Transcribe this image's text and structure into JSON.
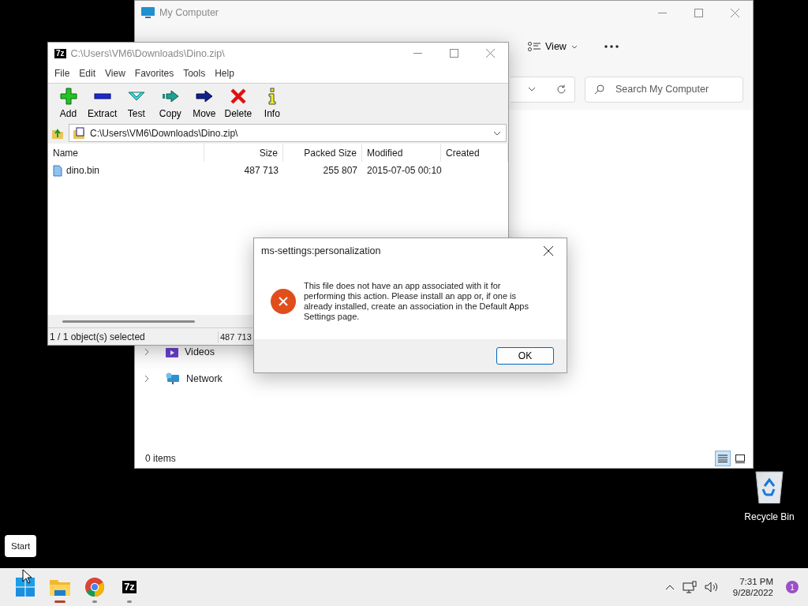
{
  "explorer": {
    "title": "My Computer",
    "view_button": "View",
    "search": {
      "placeholder": "Search My Computer"
    },
    "nav_items": [
      {
        "label": "Videos",
        "kind": "videos",
        "expanded": false
      },
      {
        "label": "Network",
        "kind": "network",
        "expanded": false
      }
    ],
    "status": "0 items",
    "view_modes": [
      {
        "kind": "details",
        "selected": true
      },
      {
        "kind": "tiles",
        "selected": false
      }
    ]
  },
  "sevenzip": {
    "logo": "7z",
    "title": "C:\\Users\\VM6\\Downloads\\Dino.zip\\",
    "menu": [
      "File",
      "Edit",
      "View",
      "Favorites",
      "Tools",
      "Help"
    ],
    "toolbar": [
      {
        "label": "Add",
        "kind": "add"
      },
      {
        "label": "Extract",
        "kind": "extract"
      },
      {
        "label": "Test",
        "kind": "test"
      },
      {
        "label": "Copy",
        "kind": "copy"
      },
      {
        "label": "Move",
        "kind": "move"
      },
      {
        "label": "Delete",
        "kind": "delete"
      },
      {
        "label": "Info",
        "kind": "info"
      }
    ],
    "address": "C:\\Users\\VM6\\Downloads\\Dino.zip\\",
    "columns": [
      "Name",
      "Size",
      "Packed Size",
      "Modified",
      "Created"
    ],
    "rows": [
      {
        "name": "dino.bin",
        "size": "487 713",
        "packed_size": "255 807",
        "modified": "2015-07-05 00:10"
      }
    ],
    "status": [
      "1 / 1 object(s) selected",
      "487 713"
    ]
  },
  "dialog": {
    "title": "ms-settings:personalization",
    "message": "This file does not have an app associated with it for performing this action. Please install an app or, if one is already installed, create an association in the Default Apps Settings page.",
    "button": "OK"
  },
  "desktop_icons": [
    {
      "label": "Recycle Bin"
    }
  ],
  "tooltip": "Start",
  "taskbar": {
    "apps": [
      {
        "kind": "start"
      },
      {
        "kind": "explorer",
        "running": true,
        "active": true
      },
      {
        "kind": "browser",
        "running": true,
        "active": false
      },
      {
        "kind": "sevenzip",
        "logo": "7z",
        "running": true,
        "active": false
      }
    ],
    "time": "7:31 PM",
    "date": "9/28/2022",
    "notifications": "1"
  }
}
